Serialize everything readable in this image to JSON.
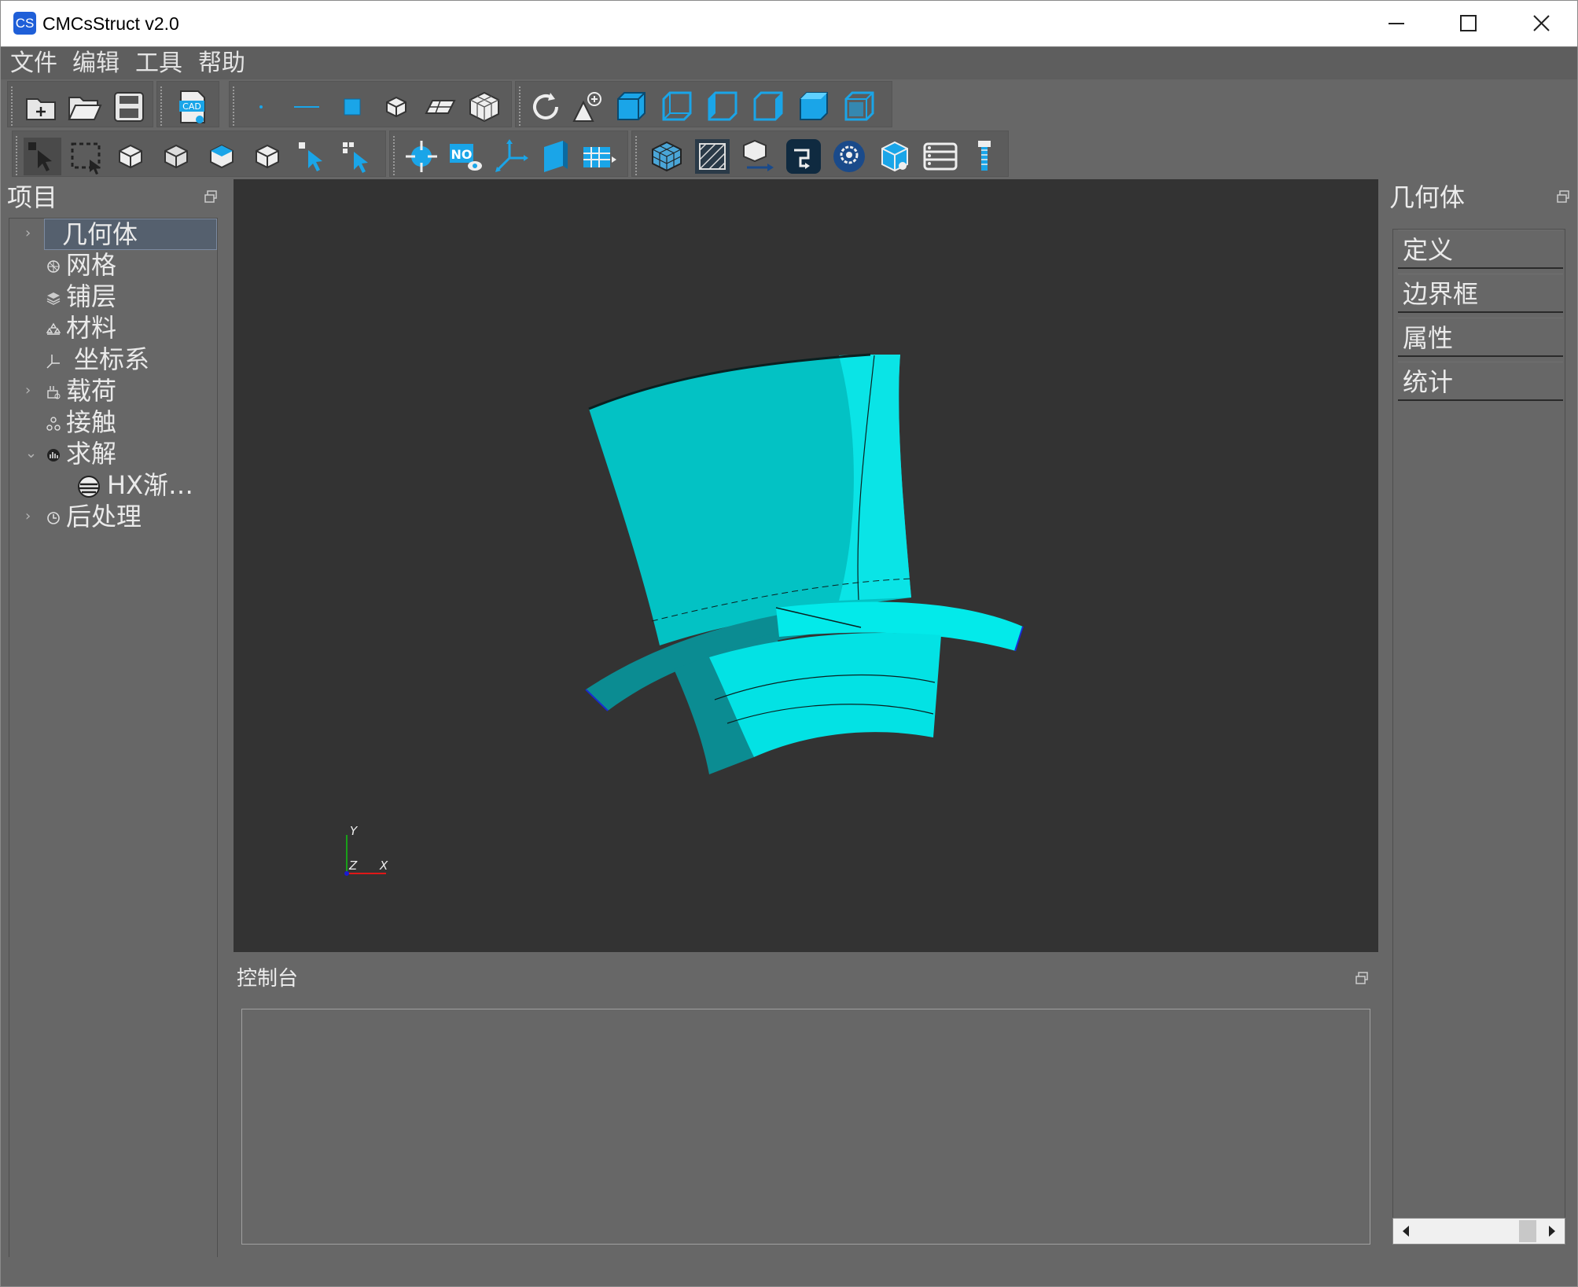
{
  "window": {
    "app_icon_text": "CS",
    "title": "CMCsStruct v2.0",
    "controls": [
      "minimize-icon",
      "maximize-icon",
      "close-icon"
    ]
  },
  "menubar": {
    "items": [
      "文件",
      "编辑",
      "工具",
      "帮助"
    ]
  },
  "toolbar_row1": {
    "icons": [
      "new-file-icon",
      "open-folder-icon",
      "save-icon",
      "cad-import-icon",
      "point-icon",
      "line-icon",
      "face-icon",
      "solid-icon",
      "plane-icon",
      "mesh-cube-icon",
      "rotate-icon",
      "zoom-fit-icon",
      "view-front-icon",
      "view-back-icon",
      "view-left-icon",
      "view-right-icon",
      "view-top-icon",
      "view-iso-icon"
    ]
  },
  "toolbar_row2": {
    "icons": [
      "select-arrow-icon",
      "box-select-icon",
      "select-vertex-icon",
      "select-edge-icon",
      "select-face-icon",
      "select-body-icon",
      "pick-point-icon",
      "pick-node-icon",
      "target-icon",
      "numbering-icon",
      "axis-icon",
      "section-icon",
      "table-icon",
      "mesh-grid-icon",
      "mesh-hatch-icon",
      "export-box-icon",
      "transfer-icon",
      "settings-gear-icon",
      "multi-cube-icon",
      "layers-list-icon",
      "probe-icon"
    ],
    "cad_label": "CAD",
    "numbering_label": "NO"
  },
  "project_panel": {
    "title": "项目",
    "tree": [
      {
        "label": "几何体",
        "icon": "geometry-icon",
        "expander": "›",
        "selected": true
      },
      {
        "label": "网格",
        "icon": "mesh-icon",
        "expander": ""
      },
      {
        "label": "铺层",
        "icon": "layers-icon",
        "expander": ""
      },
      {
        "label": "材料",
        "icon": "material-icon",
        "expander": ""
      },
      {
        "label": "坐标系",
        "icon": "axes-icon",
        "expander": ""
      },
      {
        "label": "载荷",
        "icon": "load-icon",
        "expander": "›"
      },
      {
        "label": "接触",
        "icon": "contact-icon",
        "expander": ""
      },
      {
        "label": "求解",
        "icon": "solve-icon",
        "expander": "⌄"
      },
      {
        "label": "HX渐…",
        "icon": "solver-case-icon",
        "expander": ""
      },
      {
        "label": "后处理",
        "icon": "postprocess-icon",
        "expander": "›"
      }
    ]
  },
  "viewport": {
    "background": "#333333",
    "model_color": "#00e8e8",
    "axis_labels": {
      "y": "Y",
      "z": "Z",
      "x": "X"
    }
  },
  "console_panel": {
    "title": "控制台",
    "content": ""
  },
  "geometry_panel": {
    "title": "几何体",
    "items": [
      "定义",
      "边界框",
      "属性",
      "统计"
    ]
  }
}
